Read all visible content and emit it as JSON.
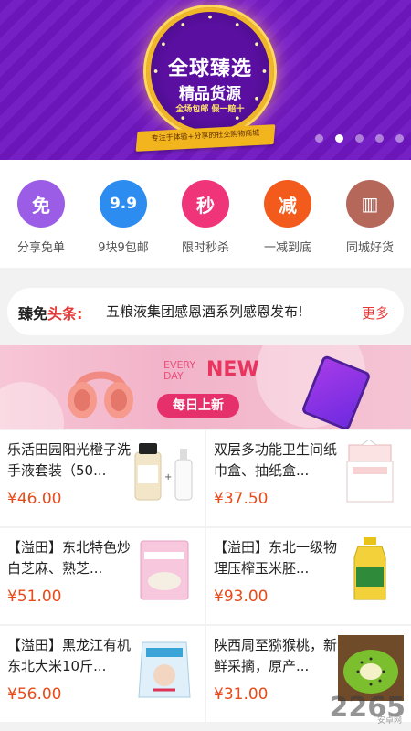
{
  "banner": {
    "title": "全球臻选",
    "subtitle": "精品货源",
    "tagline": "全场包邮  假一赔十",
    "ribbon": "专注于体验+分享的社交购物商城",
    "pager_count": 5,
    "pager_active": 1,
    "colors": {
      "bg": "#6a16b8",
      "gold": "#f0b62a"
    }
  },
  "categories": [
    {
      "icon": "free-icon",
      "glyph": "免",
      "label": "分享免单",
      "color": "#9b5de5"
    },
    {
      "icon": "nine-nine-icon",
      "glyph": "9.9",
      "label": "9块9包邮",
      "color": "#2c8cf0"
    },
    {
      "icon": "flash-sale-icon",
      "glyph": "秒",
      "label": "限时秒杀",
      "color": "#f0347a"
    },
    {
      "icon": "discount-icon",
      "glyph": "减",
      "label": "一减到底",
      "color": "#f35b1c"
    },
    {
      "icon": "local-goods-icon",
      "glyph": "▥",
      "label": "同城好货",
      "color": "#b5675a"
    }
  ],
  "headline": {
    "brand_prefix": "臻免",
    "brand_accent": "头条:",
    "text": "五粮液集团感恩酒系列感恩发布!",
    "more": "更多"
  },
  "promo": {
    "every": "EVERY",
    "day": "DAY",
    "new": "NEW",
    "pill": "每日上新"
  },
  "products": [
    {
      "name": "乐活田园阳光橙子洗手液套装（50...",
      "price": "¥46.00",
      "thumb": "bottle-icon"
    },
    {
      "name": "双层多功能卫生间纸巾盒、抽纸盒...",
      "price": "¥37.50",
      "thumb": "tissue-box-icon"
    },
    {
      "name": "【溢田】东北特色炒白芝麻、熟芝...",
      "price": "¥51.00",
      "thumb": "sesame-pack-icon"
    },
    {
      "name": "【溢田】东北一级物理压榨玉米胚...",
      "price": "¥93.00",
      "thumb": "oil-bottle-icon"
    },
    {
      "name": "【溢田】黑龙江有机东北大米10斤...",
      "price": "¥56.00",
      "thumb": "rice-bag-icon"
    },
    {
      "name": "陕西周至猕猴桃，新鲜采摘，原产...",
      "price": "¥31.00",
      "thumb": "kiwi-icon"
    }
  ],
  "watermark": {
    "main": "2265",
    "sub": "安卓网"
  }
}
